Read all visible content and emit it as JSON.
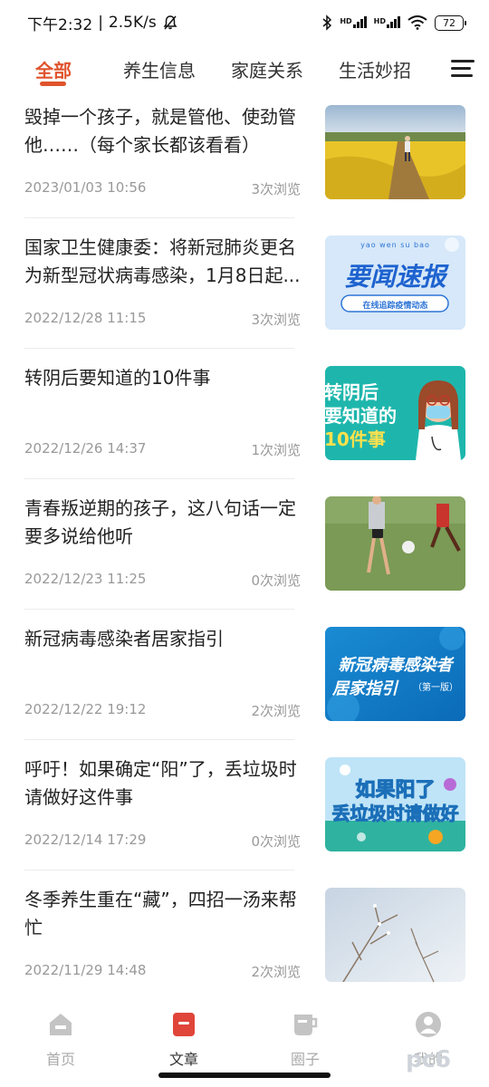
{
  "status_bar": {
    "time": "下午2:32",
    "separator": "|",
    "net_speed": "2.5K/s",
    "hd1": "HD",
    "hd2": "HD",
    "battery": "72"
  },
  "tabs": [
    {
      "label": "全部",
      "active": true
    },
    {
      "label": "养生信息",
      "active": false
    },
    {
      "label": "家庭关系",
      "active": false
    },
    {
      "label": "生活妙招",
      "active": false
    }
  ],
  "accent_color": "#e0542d",
  "articles": [
    {
      "title": "毁掉一个孩子，就是管他、使劲管他……（每个家长都该看看）",
      "date": "2023/01/03 10:56",
      "views": "3次浏览",
      "image": "rapeseed-field-child-photo"
    },
    {
      "title": "国家卫生健康委：将新冠肺炎更名为新型冠状病毒感染，1月8日起...",
      "date": "2022/12/28 11:15",
      "views": "3次浏览",
      "image": "news-banner",
      "image_pinyin": "yao  wen  su  bao",
      "image_main": "要闻速报",
      "image_sub": "在线追踪疫情动态"
    },
    {
      "title": "转阴后要知道的10件事",
      "date": "2022/12/26 14:37",
      "views": "1次浏览",
      "image": "doctor-illustration",
      "image_lines": [
        "转阴后",
        "要知道的",
        "10件事"
      ]
    },
    {
      "title": "青春叛逆期的孩子，这八句话一定要多说给他听",
      "date": "2022/12/23 11:25",
      "views": "0次浏览",
      "image": "soccer-kids-photo"
    },
    {
      "title": "新冠病毒感染者居家指引",
      "date": "2022/12/22 19:12",
      "views": "2次浏览",
      "image": "guide-banner",
      "image_lines": [
        "新冠病毒感染者",
        "居家指引"
      ],
      "image_tag": "（第一版）"
    },
    {
      "title": "呼吁！如果确定“阳”了，丢垃圾时请做好这件事",
      "date": "2022/12/14 17:29",
      "views": "0次浏览",
      "image": "garbage-banner",
      "image_lines": [
        "如果阳了",
        "丢垃圾时请做好"
      ]
    },
    {
      "title": "冬季养生重在“藏”，四招一汤来帮忙",
      "date": "2022/11/29 14:48",
      "views": "2次浏览",
      "image": "frosted-branches-photo"
    }
  ],
  "bottom_nav": [
    {
      "label": "首页",
      "icon": "home-icon",
      "active": false
    },
    {
      "label": "文章",
      "icon": "article-icon",
      "active": true
    },
    {
      "label": "圈子",
      "icon": "cup-icon",
      "active": false
    },
    {
      "label": "我的",
      "icon": "profile-icon",
      "active": false
    }
  ],
  "watermark": "pc6"
}
